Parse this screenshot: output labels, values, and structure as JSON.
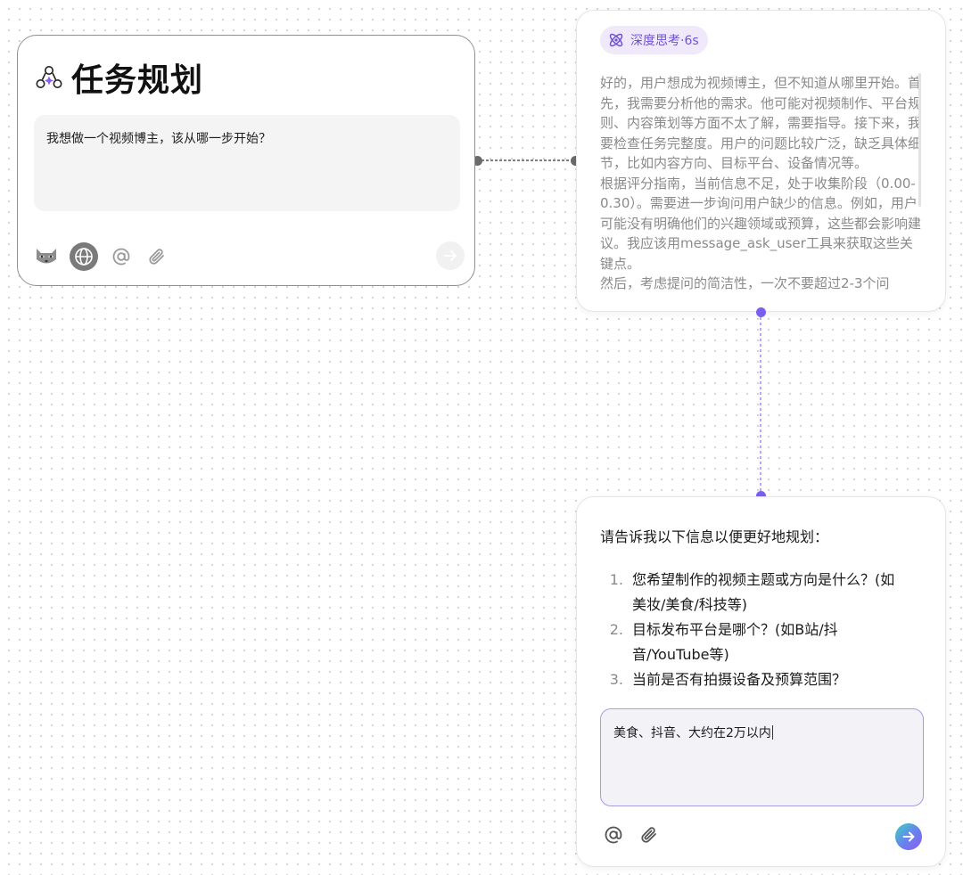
{
  "task_card": {
    "title": "任务规划",
    "input_text": "我想做一个视频博主，该从哪一步开始？",
    "tools": [
      "raccoon-icon",
      "globe-icon",
      "at-icon",
      "paperclip-icon"
    ],
    "send_icon": "arrow-right-icon"
  },
  "thinking_card": {
    "badge_label": "深度思考·6s",
    "badge_icon": "atom-icon",
    "paragraphs": [
      "好的，用户想成为视频博主，但不知道从哪里开始。首先，我需要分析他的需求。他可能对视频制作、平台规则、内容策划等方面不太了解，需要指导。接下来，我要检查任务完整度。用户的问题比较广泛，缺乏具体细节，比如内容方向、目标平台、设备情况等。",
      "根据评分指南，当前信息不足，处于收集阶段（0.00-0.30）。需要进一步询问用户缺少的信息。例如，用户可能没有明确他们的兴趣领域或预算，这些都会影响建议。我应该用message_ask_user工具来获取这些关键点。",
      "然后，考虑提问的简洁性，一次不要超过2-3个问"
    ]
  },
  "question_card": {
    "intro": "请告诉我以下信息以便更好地规划：",
    "questions": [
      {
        "num": "1.",
        "lines": [
          "您希望制作的视频主题或方向是什么？(如",
          "美妆/美食/科技等)"
        ]
      },
      {
        "num": "2.",
        "lines": [
          "目标发布平台是哪个？(如B站/抖",
          "音/YouTube等)"
        ]
      },
      {
        "num": "3.",
        "lines": [
          "当前是否有拍摄设备及预算范围？"
        ]
      }
    ],
    "input_value": "美食、抖音、大约在2万以内",
    "tools": [
      "at-icon",
      "paperclip-icon"
    ],
    "send_icon": "arrow-right-icon"
  },
  "colors": {
    "accent": "#6f52d8",
    "badge_bg": "#efe9fb",
    "card_border": "#8f8f8f",
    "muted_text": "#8a8a8a",
    "connector_purple": "#7a5ef0"
  }
}
